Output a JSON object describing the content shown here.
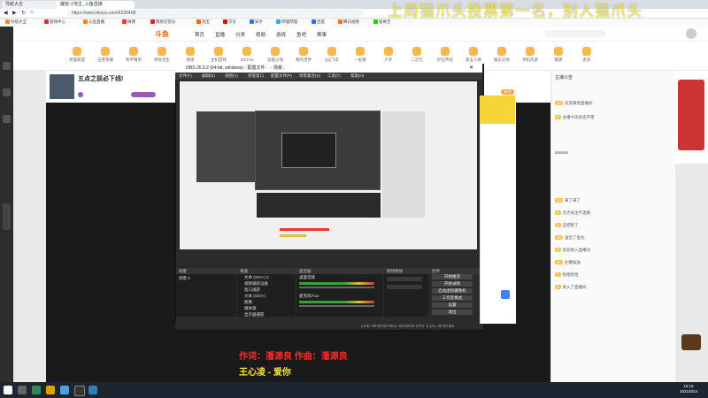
{
  "browser": {
    "tabs": [
      "导航大全",
      "魔兽斗地主_斗鱼直播"
    ],
    "address": "https://www.douyu.com/6230408",
    "bookmarks": [
      "导航大全",
      "游戏中心",
      "斗鱼直播",
      "微博",
      "网易云音乐",
      "淘宝",
      "京东",
      "知乎",
      "哔哩哔哩",
      "百度",
      "腾讯视频",
      "爱奇艺"
    ]
  },
  "site": {
    "logo": "斗鱼",
    "nav": [
      "首页",
      "直播",
      "分类",
      "视频",
      "游戏",
      "鱼吧",
      "赛事"
    ],
    "categories": [
      "英雄联盟",
      "王者荣耀",
      "和平精英",
      "绝地求生",
      "颜值",
      "主机游戏",
      "DOTA2",
      "穿越火线",
      "我的世界",
      "QQ飞车",
      "一起看",
      "户外",
      "二次元",
      "炉石传说",
      "第五人格",
      "娱乐天地",
      "单机热游",
      "棋牌",
      "更多"
    ],
    "room_title": "五点之前必下线!",
    "follow_label": "关注",
    "chat_title": "主播公告",
    "chat_lines": [
      "欢迎来到直播间",
      "主播今天状态不错",
      "666666",
      "来了来了",
      "点点关注不迷路",
      "这把稳了",
      "送出了鱼丸",
      "欢迎进入直播间",
      "主播加油",
      "哈哈哈哈",
      "进入了直播间"
    ]
  },
  "obs": {
    "title": "OBS 26.0.2 (64-bit, windows) - 配置文件：  - 场景：",
    "menu": [
      "文件(F)",
      "编辑(E)",
      "视图(V)",
      "停靠窗口",
      "配置文件(P)",
      "场景集合(S)",
      "工具(T)",
      "帮助(H)"
    ],
    "panels": [
      "场景",
      "来源",
      "混音器",
      "转场特效",
      "控件"
    ],
    "scene": "场景 2",
    "sources": [
      "文本 (GDI+) 2",
      "视频捕获设备",
      "窗口捕获",
      "文本 (GDI+)",
      "图像",
      "媒体源",
      "显示器捕获"
    ],
    "mixer": [
      "桌面音频",
      "麦克风/Aux"
    ],
    "controls": [
      "开始推流",
      "开始录制",
      "启动虚拟摄像机",
      "工作室模式",
      "设置",
      "退出"
    ],
    "status": "LIVE: 00:00:00  REC: 00:00:00  CPU: 2.1%, 30.00 fps"
  },
  "overlay": {
    "top_banner": "上周猫爪头投票第一名，别人猫爪头",
    "lyric_line1": "作词：潘源良  作曲：潘源良",
    "lyric_line2": "王心凌 - 爱你"
  },
  "taskbar": {
    "time": "19:15",
    "date": "2021/8/24"
  }
}
